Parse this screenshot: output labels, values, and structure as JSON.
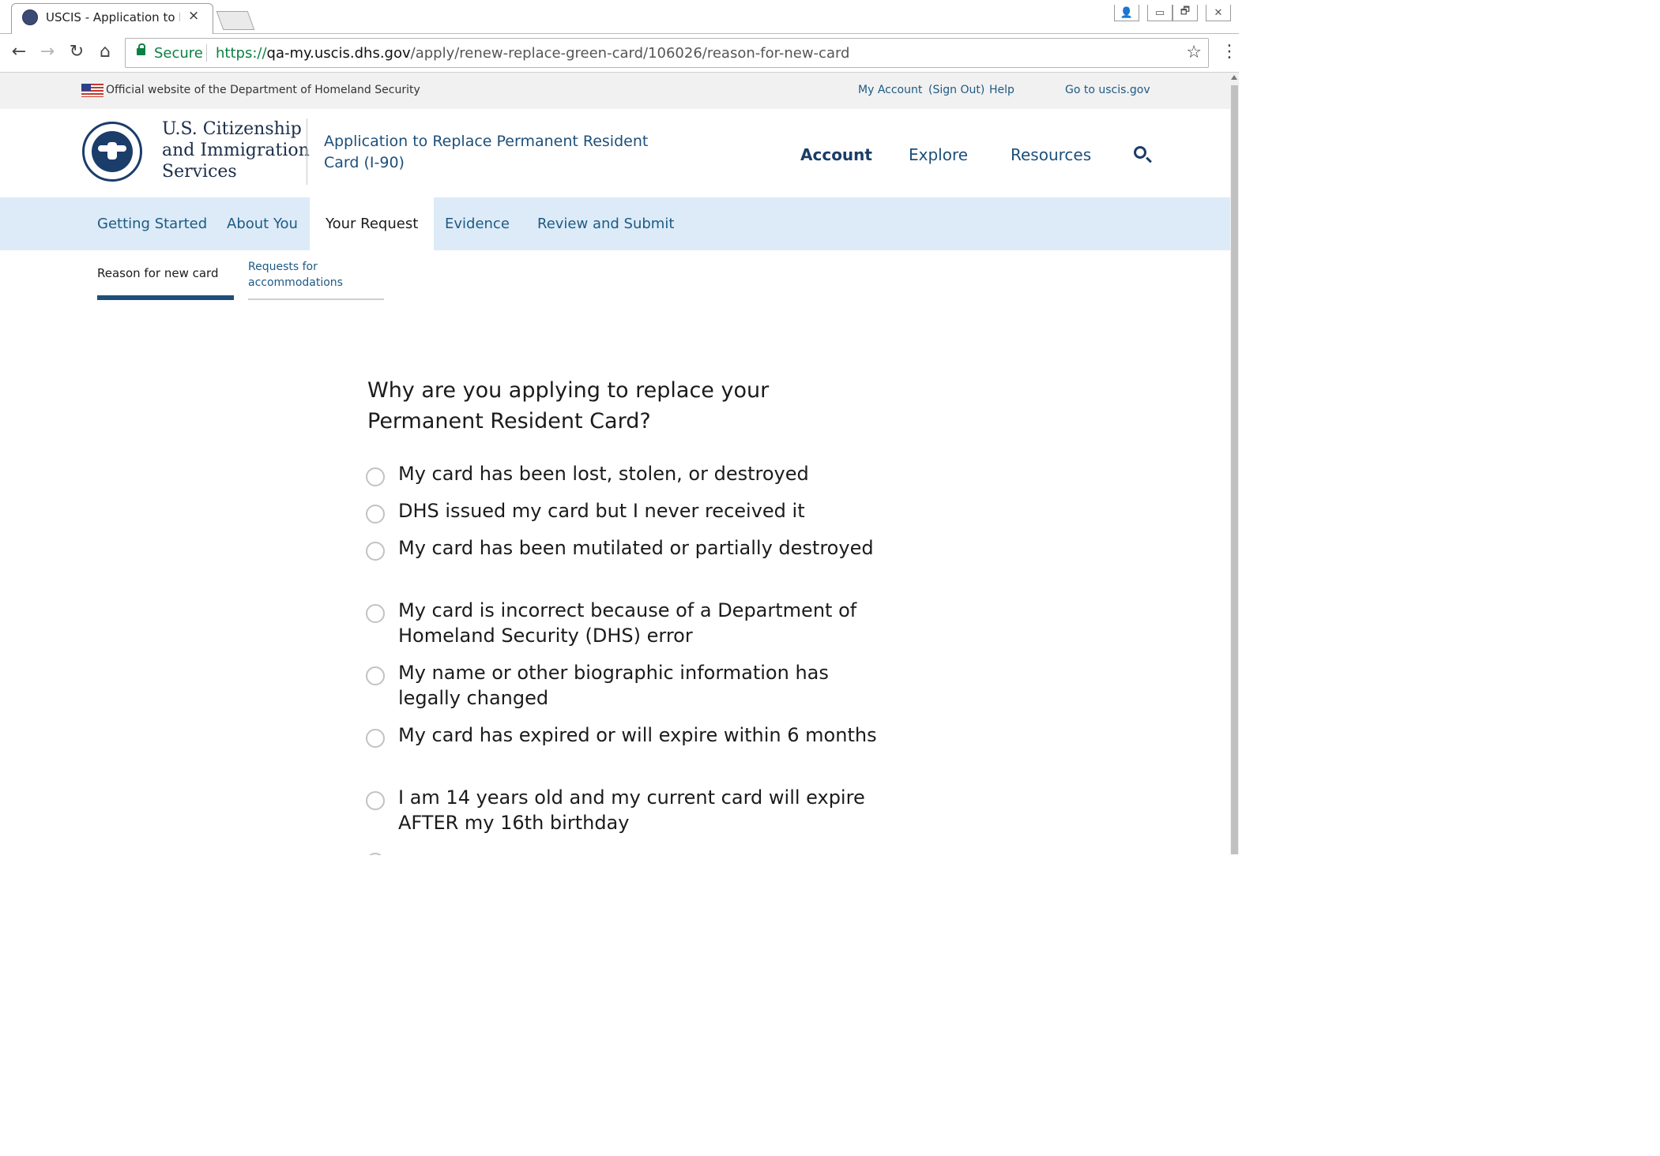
{
  "browser": {
    "tab_title": "USCIS - Application to Re",
    "tab_close": "×",
    "secure_label": "Secure",
    "url_scheme": "https://",
    "url_host": "qa-my.uscis.dhs.gov",
    "url_path": "/apply/renew-replace-green-card/106026/reason-for-new-card",
    "back": "←",
    "forward": "→",
    "reload": "↻",
    "home": "⌂",
    "star": "☆",
    "menu": "⋮",
    "win_user": "👤",
    "win_minimize": "▭",
    "win_restore": "🗗",
    "win_close": "✕"
  },
  "banner": {
    "official_text": "Official website of the Department of Homeland Security",
    "my_account": "My Account",
    "sign_out": "(Sign Out)",
    "help": "Help",
    "go_to_uscis": "Go to uscis.gov"
  },
  "header": {
    "agency_line1": "U.S. Citizenship",
    "agency_line2": "and Immigration",
    "agency_line3": "Services",
    "app_title": "Application to Replace Permanent Resident Card (I-90)",
    "nav": {
      "account": "Account",
      "explore": "Explore",
      "resources": "Resources"
    }
  },
  "steps": [
    {
      "label": "Getting Started"
    },
    {
      "label": "About You"
    },
    {
      "label": "Your Request"
    },
    {
      "label": "Evidence"
    },
    {
      "label": "Review and Submit"
    }
  ],
  "substeps": [
    {
      "label": "Reason for new card"
    },
    {
      "label": "Requests for accommodations"
    }
  ],
  "question": "Why are you applying to replace your Permanent Resident Card?",
  "options": [
    {
      "label": "My card has been lost, stolen, or destroyed",
      "selected": false
    },
    {
      "label": "DHS issued my card but I never received it",
      "selected": false
    },
    {
      "label": "My card has been mutilated or partially destroyed",
      "selected": false
    },
    {
      "label": "My card is incorrect because of a Department of Homeland Security (DHS) error",
      "selected": false
    },
    {
      "label": "My name or other biographic information has legally changed",
      "selected": false
    },
    {
      "label": "My card has expired or will expire within 6 months",
      "selected": false
    },
    {
      "label": "I am 14 years old and my current card will expire AFTER my 16th birthday",
      "selected": false
    }
  ],
  "colors": {
    "primary_blue": "#1d4f7a",
    "link_blue": "#1d5a84",
    "stepnav_bg": "#dcebf7",
    "secure_green": "#0b8043"
  }
}
